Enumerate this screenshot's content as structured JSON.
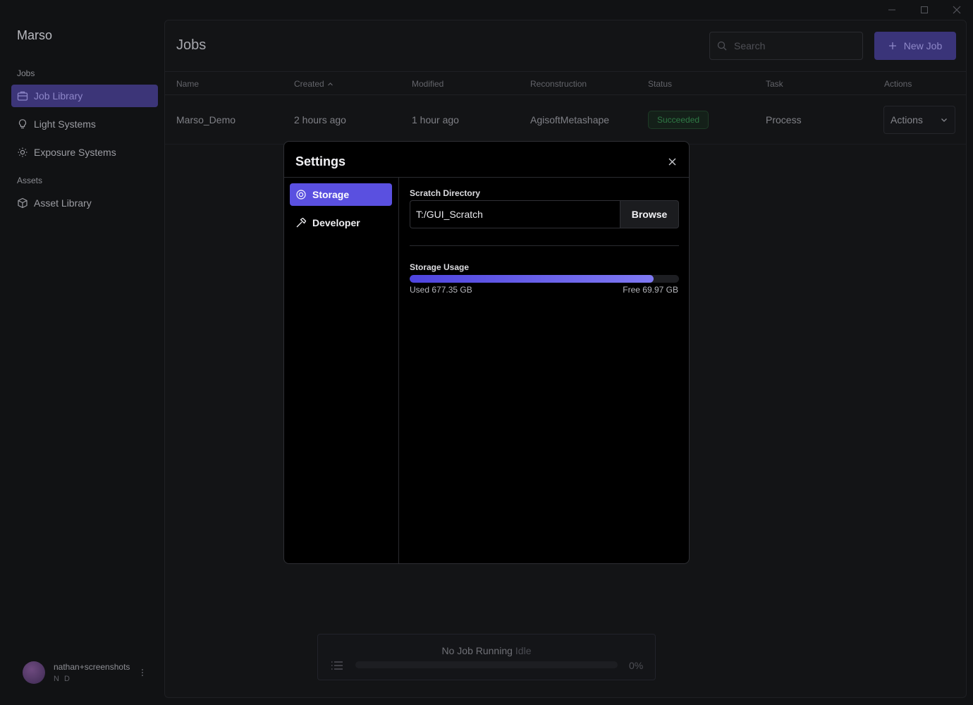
{
  "app": {
    "title": "Marso"
  },
  "sidebar": {
    "sections": [
      {
        "label": "Jobs"
      },
      {
        "label": "Assets"
      }
    ],
    "items": [
      {
        "label": "Job Library",
        "icon": "briefcase-icon",
        "active": true
      },
      {
        "label": "Light Systems",
        "icon": "lightbulb-icon",
        "active": false
      },
      {
        "label": "Exposure Systems",
        "icon": "sun-icon",
        "active": false
      },
      {
        "label": "Asset Library",
        "icon": "box-icon",
        "active": false
      }
    ]
  },
  "user": {
    "name": "nathan+screenshots",
    "initials": "N D"
  },
  "main": {
    "title": "Jobs",
    "search": {
      "placeholder": "Search",
      "value": ""
    },
    "new_job_label": "New Job",
    "table": {
      "columns": [
        "Name",
        "Created",
        "Modified",
        "Reconstruction",
        "Status",
        "Task",
        "Actions"
      ],
      "sorted_column": "Created",
      "sort_direction": "ascending",
      "rows": [
        {
          "name": "Marso_Demo",
          "created": "2 hours ago",
          "modified": "1 hour ago",
          "reconstruction": "AgisoftMetashape",
          "status": "Succeeded",
          "task": "Process",
          "actions_label": "Actions"
        }
      ]
    }
  },
  "job_status": {
    "title": "No Job Running",
    "state": "Idle",
    "progress_label": "0%",
    "progress": 0
  },
  "settings": {
    "title": "Settings",
    "nav": [
      {
        "label": "Storage",
        "icon": "storage-icon",
        "active": true
      },
      {
        "label": "Developer",
        "icon": "hammer-icon",
        "active": false
      }
    ],
    "scratch_directory": {
      "label": "Scratch Directory",
      "value": "T:/GUI_Scratch",
      "browse_label": "Browse"
    },
    "storage_usage": {
      "label": "Storage Usage",
      "used_label": "Used 677.35 GB",
      "free_label": "Free 69.97 GB",
      "used_gb": 677.35,
      "free_gb": 69.97
    }
  },
  "colors": {
    "accent": "#5a50e0",
    "accent_muted": "#3c3578",
    "success": "#2f7a45",
    "background": "#111214",
    "modal_background": "#000000"
  }
}
